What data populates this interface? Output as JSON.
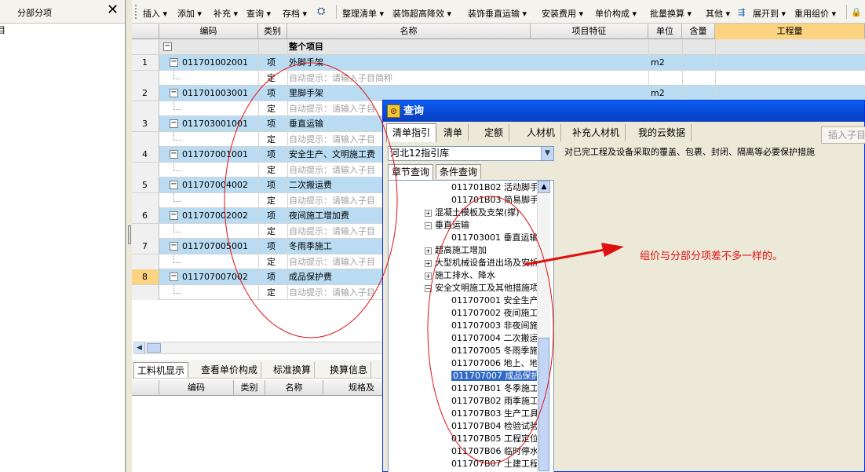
{
  "left_panel": {
    "title": "分部分项",
    "close_glyph": "✕",
    "tree_root": "目"
  },
  "toolbar": {
    "items": [
      "插入 ▾",
      "添加 ▾",
      "补充 ▾",
      "查询 ▾",
      "存档 ▾",
      "整理清单 ▾",
      "装饰超高降效 ▾",
      "装饰垂直运输 ▾",
      "安装费用 ▾",
      "单价构成 ▾",
      "批量换算 ▾",
      "其他 ▾",
      "展开到 ▾",
      "重用组价 ▾"
    ]
  },
  "grid": {
    "headers": [
      "编码",
      "类别",
      "名称",
      "项目特征",
      "单位",
      "含量",
      "工程量"
    ],
    "total_row": {
      "name": "整个项目"
    },
    "rows": [
      {
        "no": "1",
        "code": "011701002001",
        "type": "项",
        "name": "外脚手架",
        "unit": "m2"
      },
      {
        "type": "定",
        "hint": "自动提示：请输入子目简称"
      },
      {
        "no": "2",
        "code": "011701003001",
        "type": "项",
        "name": "里脚手架",
        "unit": "m2"
      },
      {
        "type": "定",
        "hint": "自动提示：请输入子目"
      },
      {
        "no": "3",
        "code": "011703001001",
        "type": "项",
        "name": "垂直运输",
        "unit": ""
      },
      {
        "type": "定",
        "hint": "自动提示：请输入子目"
      },
      {
        "no": "4",
        "code": "011707001001",
        "type": "项",
        "name": "安全生产、文明施工费",
        "unit": ""
      },
      {
        "type": "定",
        "hint": "自动提示：请输入子目"
      },
      {
        "no": "5",
        "code": "011707004002",
        "type": "项",
        "name": "二次搬运费",
        "unit": ""
      },
      {
        "type": "定",
        "hint": "自动提示：请输入子目"
      },
      {
        "no": "6",
        "code": "011707002002",
        "type": "项",
        "name": "夜间施工增加费",
        "unit": ""
      },
      {
        "type": "定",
        "hint": "自动提示：请输入子目"
      },
      {
        "no": "7",
        "code": "011707005001",
        "type": "项",
        "name": "冬雨季施工",
        "unit": ""
      },
      {
        "type": "定",
        "hint": "自动提示：请输入子目"
      },
      {
        "no": "8",
        "code": "011707007002",
        "type": "项",
        "name": "成品保护费",
        "unit": ""
      },
      {
        "type": "定",
        "hint": "自动提示：请输入子目"
      }
    ]
  },
  "bottom": {
    "tabs": [
      "工料机显示",
      "查看单价构成",
      "标准换算",
      "换算信息"
    ],
    "headers": [
      "编码",
      "类别",
      "名称",
      "规格及"
    ]
  },
  "dialog": {
    "title": "查询",
    "tabs": [
      "清单指引",
      "清单",
      "定额",
      "人材机",
      "补充人材机",
      "我的云数据"
    ],
    "insert_button": "插入子目",
    "library": "河北12指引库",
    "subtabs": [
      "章节查询",
      "条件查询"
    ],
    "tree": [
      {
        "indent": 3,
        "text": "011701B02  活动脚手",
        "box": ""
      },
      {
        "indent": 3,
        "text": "011701B03  简易脚手",
        "box": ""
      },
      {
        "indent": 1,
        "text": "混凝土模板及支架(撑)",
        "box": "+"
      },
      {
        "indent": 1,
        "text": "垂直运输",
        "box": "-"
      },
      {
        "indent": 3,
        "text": "011703001  垂直运输",
        "box": ""
      },
      {
        "indent": 1,
        "text": "超高施工增加",
        "box": "+"
      },
      {
        "indent": 1,
        "text": "大型机械设备进出场及安拆",
        "box": "+"
      },
      {
        "indent": 1,
        "text": "施工排水、降水",
        "box": "+"
      },
      {
        "indent": 1,
        "text": "安全文明施工及其他措施项目",
        "box": "-"
      },
      {
        "indent": 3,
        "text": "011707001  安全生产",
        "box": ""
      },
      {
        "indent": 3,
        "text": "011707002  夜间施工",
        "box": ""
      },
      {
        "indent": 3,
        "text": "011707003  非夜间施工",
        "box": ""
      },
      {
        "indent": 3,
        "text": "011707004  二次搬运",
        "box": ""
      },
      {
        "indent": 3,
        "text": "011707005  冬雨季施",
        "box": ""
      },
      {
        "indent": 3,
        "text": "011707006  地上、地",
        "box": ""
      },
      {
        "indent": 3,
        "text": "011707007  成品保护",
        "box": "",
        "selected": true
      },
      {
        "indent": 3,
        "text": "011707B01  冬季施工",
        "box": ""
      },
      {
        "indent": 3,
        "text": "011707B02  雨季施工",
        "box": ""
      },
      {
        "indent": 3,
        "text": "011707B03  生产工具",
        "box": ""
      },
      {
        "indent": 3,
        "text": "011707B04  检验试验",
        "box": ""
      },
      {
        "indent": 3,
        "text": "011707B05  工程定位",
        "box": ""
      },
      {
        "indent": 3,
        "text": "011707B06  临时停水",
        "box": ""
      },
      {
        "indent": 3,
        "text": "011707B07  土建工程",
        "box": ""
      }
    ],
    "description": "对已完工程及设备采取的覆盖、包裹、封闭、隔离等必要保护措施"
  },
  "annotation": {
    "text": "组价与分部分项差不多一样的。",
    "color": "#e01010"
  },
  "colors": {
    "row_highlight": "#b9dcf3",
    "title_blue": "#0847d4",
    "column_accent": "#fbd381"
  }
}
